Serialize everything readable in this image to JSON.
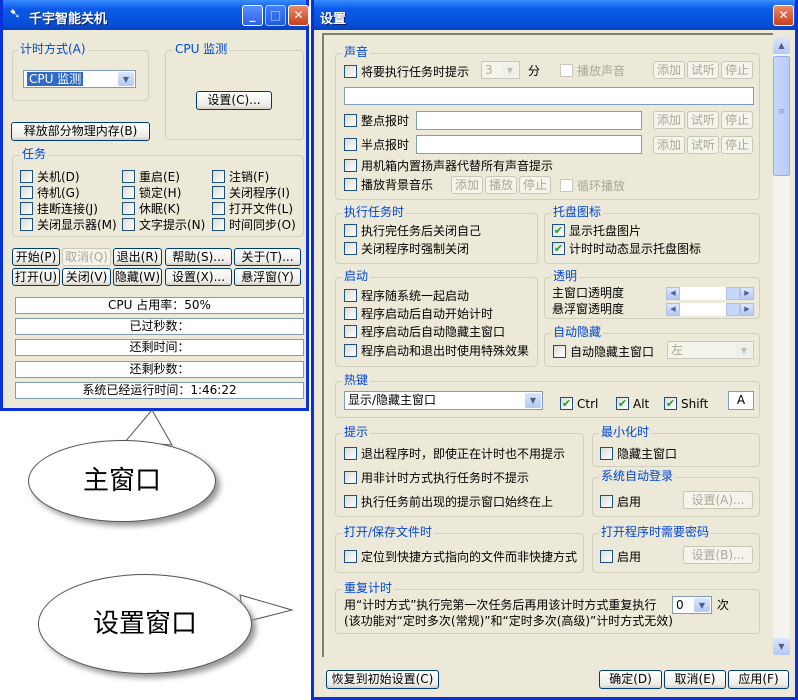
{
  "main": {
    "title": "千宇智能关机",
    "timing_group": "计时方式(A)",
    "timing_value": "CPU 监测",
    "cpu_group": "CPU 监测",
    "cpu_settings": "设置(C)...",
    "release_mem": "释放部分物理内存(B)",
    "task_group": "任务",
    "tasks": [
      "关机(D)",
      "重启(E)",
      "注销(F)",
      "待机(G)",
      "锁定(H)",
      "关闭程序(I)",
      "挂断连接(J)",
      "休眠(K)",
      "打开文件(L)",
      "关闭显示器(M)",
      "文字提示(N)",
      "时间同步(O)"
    ],
    "buttons": [
      "开始(P)",
      "取消(Q)",
      "退出(R)",
      "帮助(S)...",
      "关于(T)...",
      "打开(U)",
      "关闭(V)",
      "隐藏(W)",
      "设置(X)...",
      "悬浮窗(Y)"
    ],
    "status": [
      "CPU 占用率：50%",
      "已过秒数：",
      "还剩时间：",
      "还剩秒数：",
      "系统已经运行时间：1:46:22"
    ]
  },
  "callouts": {
    "main": "主窗口",
    "settings": "设置窗口"
  },
  "settings": {
    "title": "设置",
    "sound": {
      "legend": "声音",
      "remind": "将要执行任务时提示",
      "minutes": "3",
      "min_unit": "分",
      "play_sound": "播放声音",
      "add": "添加",
      "listen": "试听",
      "stop": "停止",
      "hourly": "整点报时",
      "half_hourly": "半点报时",
      "speaker": "用机箱内置扬声器代替所有声音提示",
      "bgm": "播放背景音乐",
      "play": "播放",
      "loop": "循环播放"
    },
    "exec": {
      "legend": "执行任务时",
      "items": [
        "执行完任务后关闭自己",
        "关闭程序时强制关闭"
      ]
    },
    "tray": {
      "legend": "托盘图标",
      "items": [
        "显示托盘图片",
        "计时时动态显示托盘图标"
      ]
    },
    "startup": {
      "legend": "启动",
      "items": [
        "程序随系统一起启动",
        "程序启动后自动开始计时",
        "程序启动后自动隐藏主窗口",
        "程序启动和退出时使用特殊效果"
      ]
    },
    "transparency": {
      "legend": "透明",
      "main": "主窗口透明度",
      "float": "悬浮窗透明度",
      "main_value": 1.0,
      "float_value": 1.0
    },
    "autohide": {
      "legend": "自动隐藏",
      "item": "自动隐藏主窗口",
      "side": "左"
    },
    "hotkey": {
      "legend": "热键",
      "action": "显示/隐藏主窗口",
      "ctrl": "Ctrl",
      "alt": "Alt",
      "shift": "Shift",
      "key": "A"
    },
    "prompt": {
      "legend": "提示",
      "items": [
        "退出程序时，即使正在计时也不用提示",
        "用非计时方式执行任务时不提示",
        "执行任务前出现的提示窗口始终在上"
      ]
    },
    "minimize": {
      "legend": "最小化时",
      "item": "隐藏主窗口"
    },
    "autologin": {
      "legend": "系统自动登录",
      "item": "启用",
      "button": "设置(A)..."
    },
    "files": {
      "legend": "打开/保存文件时",
      "item": "定位到快捷方式指向的文件而非快捷方式"
    },
    "password": {
      "legend": "打开程序时需要密码",
      "item": "启用",
      "button": "设置(B)..."
    },
    "repeat": {
      "legend": "重复计时",
      "line1": "用“计时方式”执行完第一次任务后再用该计时方式重复执行",
      "count": "0",
      "unit": "次",
      "line2": "(该功能对“定时多次(常规)”和“定时多次(高级)”计时方式无效)"
    },
    "restore": "恢复到初始设置(C)",
    "ok": "确定(D)",
    "cancel": "取消(E)",
    "apply": "应用(F)"
  }
}
